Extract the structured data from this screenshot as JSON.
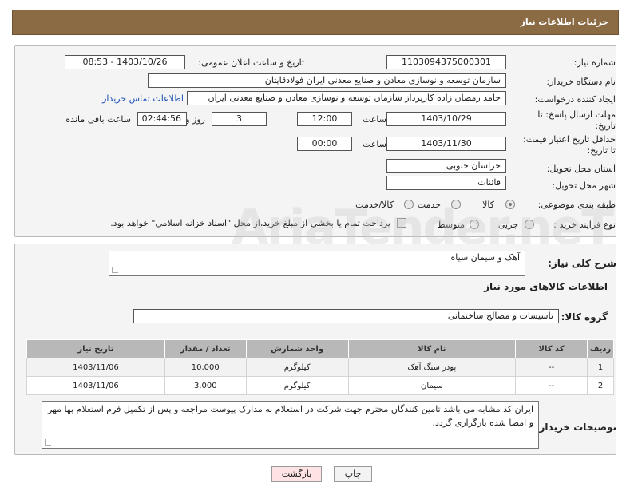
{
  "header": {
    "title": "جزئیات اطلاعات نیاز"
  },
  "form": {
    "need_number": {
      "label": "شماره نیاز:",
      "value": "1103094375000301"
    },
    "announce_datetime": {
      "label": "تاریخ و ساعت اعلان عمومی:",
      "value": "1403/10/26 - 08:53"
    },
    "buyer_org": {
      "label": "نام دستگاه خریدار:",
      "value": "سازمان توسعه و نوسازی معادن و صنایع معدنی ایران فولادقاپتان"
    },
    "requester": {
      "label": "ایجاد کننده درخواست:",
      "value": "حامد  رمضان زاده  کارپرداز  سازمان توسعه و نوسازی معادن و صنایع معدنی ایران",
      "contact_link": "اطلاعات تماس خریدار"
    },
    "response_deadline": {
      "label": "مهلت ارسال پاسخ: تا تاریخ:",
      "date": "1403/10/29",
      "time_label": "ساعت",
      "time": "12:00",
      "days": "3",
      "days_label": "روز و",
      "remaining": "02:44:56",
      "remaining_label": "ساعت باقی مانده"
    },
    "price_validity": {
      "label": "حداقل تاریخ اعتبار قیمت: تا تاریخ:",
      "date": "1403/11/30",
      "time_label": "ساعت",
      "time": "00:00"
    },
    "delivery_province": {
      "label": "استان محل تحویل:",
      "value": "خراسان جنوبی"
    },
    "delivery_city": {
      "label": "شهر محل تحویل:",
      "value": "قائنات"
    },
    "category": {
      "label": "طبقه بندی موضوعی:",
      "options": [
        "کالا",
        "خدمت",
        "کالا/خدمت"
      ],
      "selected": "کالا"
    },
    "purchase_type": {
      "label": "نوع فرآیند خرید :",
      "options": [
        "جزیی",
        "متوسط"
      ],
      "payment_note": "پرداخت تمام یا بخشی از مبلغ خرید،از محل \"اسناد خزانه اسلامی\" خواهد بود."
    }
  },
  "details": {
    "description_label": "شرح کلی نیاز:",
    "description": "آهک و سیمان سیاه",
    "goods_info_title": "اطلاعات کالاهای مورد نیاز",
    "group_label": "گروه کالا:",
    "group_value": "تاسیسات و مصالح ساختمانی",
    "table": {
      "headers": [
        "ردیف",
        "کد کالا",
        "نام کالا",
        "واحد شمارش",
        "تعداد / مقدار",
        "تاریخ نیاز"
      ],
      "rows": [
        [
          "1",
          "--",
          "پودر سنگ آهک",
          "کیلوگرم",
          "10,000",
          "1403/11/06"
        ],
        [
          "2",
          "--",
          "سیمان",
          "کیلوگرم",
          "3,000",
          "1403/11/06"
        ]
      ]
    },
    "buyer_notes_label": "توضیحات خریدار:",
    "buyer_notes": "ایران کد مشابه می باشد تامین کنندگان محترم جهت شرکت در استعلام به مدارک پیوست مراجعه و پس از تکمیل فرم استعلام بها مهر و امضا شده بارگزاری گردد."
  },
  "buttons": {
    "print": "چاپ",
    "back": "بازگشت"
  },
  "colors": {
    "header_bg": "#8b6b44",
    "link": "#1a4fb5",
    "back_button_bg": "#fde3e3"
  }
}
